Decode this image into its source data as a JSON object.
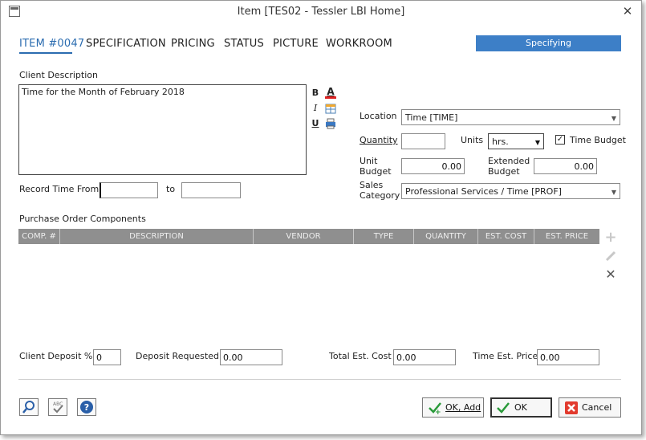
{
  "window": {
    "title": "Item [TES02 - Tessler LBI Home]"
  },
  "tabs": [
    {
      "label": "ITEM #0047",
      "active": true
    },
    {
      "label": "SPECIFICATION"
    },
    {
      "label": "PRICING"
    },
    {
      "label": "STATUS"
    },
    {
      "label": "PICTURE"
    },
    {
      "label": "WORKROOM"
    }
  ],
  "status": "Specifying",
  "client_description": {
    "label": "Client Description",
    "value": "Time for the Month of February 2018",
    "format_buttons": {
      "bold": "B",
      "italic": "I",
      "underline": "U",
      "font_color": "A"
    }
  },
  "record_time": {
    "from_label": "Record Time From",
    "to_label": "to",
    "from_value": "",
    "to_value": ""
  },
  "fields": {
    "location_label": "Location",
    "location_value": "Time [TIME]",
    "quantity_label": "Quantity",
    "quantity_value": "",
    "units_label": "Units",
    "units_value": "hrs.",
    "time_budget_label": "Time Budget",
    "time_budget_checked": true,
    "unit_budget_label_1": "Unit",
    "unit_budget_label_2": "Budget",
    "unit_budget_value": "0.00",
    "extended_budget_label_1": "Extended",
    "extended_budget_label_2": "Budget",
    "extended_budget_value": "0.00",
    "sales_category_label_1": "Sales",
    "sales_category_label_2": "Category",
    "sales_category_value": "Professional Services / Time [PROF]"
  },
  "po_components": {
    "label": "Purchase Order Components",
    "columns": [
      "COMP. #",
      "DESCRIPTION",
      "VENDOR",
      "TYPE",
      "QUANTITY",
      "EST. COST",
      "EST. PRICE"
    ],
    "rows": []
  },
  "totals": {
    "client_deposit_label": "Client Deposit %",
    "client_deposit_value": "0",
    "deposit_requested_label": "Deposit Requested",
    "deposit_requested_value": "0.00",
    "total_est_cost_label": "Total Est. Cost",
    "total_est_cost_value": "0.00",
    "time_est_price_label": "Time Est. Price",
    "time_est_price_value": "0.00"
  },
  "buttons": {
    "ok_add": "OK, Add",
    "ok": "OK",
    "cancel": "Cancel"
  },
  "colors": {
    "accent": "#2b6cb0",
    "status_bg": "#3d7fc7",
    "grid_header": "#8f8f8f"
  }
}
